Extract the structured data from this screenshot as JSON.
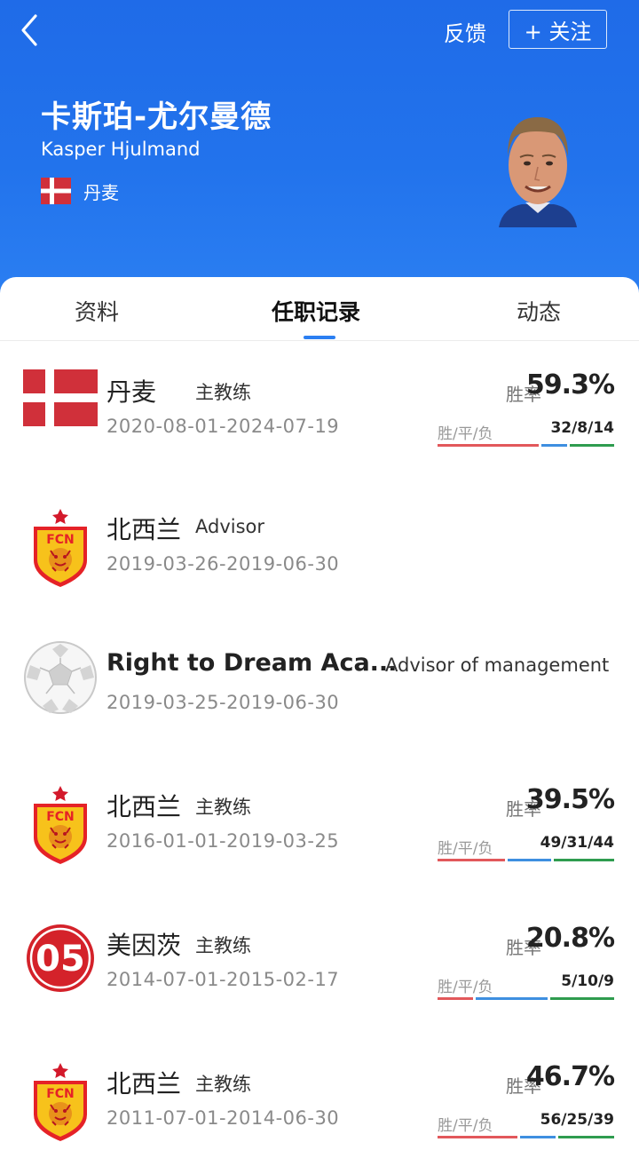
{
  "header": {
    "feedback_label": "反馈",
    "follow_label": "+ 关注",
    "name_cn": "卡斯珀-尤尔曼德",
    "name_en": "Kasper Hjulmand",
    "nationality": "丹麦"
  },
  "tabs": [
    {
      "label": "资料",
      "active": false
    },
    {
      "label": "任职记录",
      "active": true
    },
    {
      "label": "动态",
      "active": false
    }
  ],
  "records": [
    {
      "team": "丹麦",
      "role": "主教练",
      "dates": "2020-08-01-2024-07-19",
      "rate_label": "胜率",
      "win_rate": "59.3%",
      "wdl_label": "胜/平/负",
      "wdl": "32/8/14",
      "w": 32,
      "d": 8,
      "l": 14,
      "logo": "denmark-flag"
    },
    {
      "team": "北西兰",
      "role": "Advisor",
      "dates": "2019-03-26-2019-06-30",
      "logo": "fc-nordsjaelland-crest"
    },
    {
      "team": "Right to Dream Aca...",
      "role": "Advisor of management",
      "dates": "2019-03-25-2019-06-30",
      "logo": "soccer-ball"
    },
    {
      "team": "北西兰",
      "role": "主教练",
      "dates": "2016-01-01-2019-03-25",
      "rate_label": "胜率",
      "win_rate": "39.5%",
      "wdl_label": "胜/平/负",
      "wdl": "49/31/44",
      "w": 49,
      "d": 31,
      "l": 44,
      "logo": "fc-nordsjaelland-crest"
    },
    {
      "team": "美因茨",
      "role": "主教练",
      "dates": "2014-07-01-2015-02-17",
      "rate_label": "胜率",
      "win_rate": "20.8%",
      "wdl_label": "胜/平/负",
      "wdl": "5/10/9",
      "w": 5,
      "d": 10,
      "l": 9,
      "logo": "mainz-05-crest"
    },
    {
      "team": "北西兰",
      "role": "主教练",
      "dates": "2011-07-01-2014-06-30",
      "rate_label": "胜率",
      "win_rate": "46.7%",
      "wdl_label": "胜/平/负",
      "wdl": "56/25/39",
      "w": 56,
      "d": 25,
      "l": 39,
      "logo": "fc-nordsjaelland-crest"
    }
  ],
  "colors": {
    "header_blue": "#2273ec",
    "win_bar": "#e2585b",
    "draw_bar": "#3e8fe0",
    "loss_bar": "#2f9c4f",
    "tab_indicator": "#2b7ff2"
  }
}
